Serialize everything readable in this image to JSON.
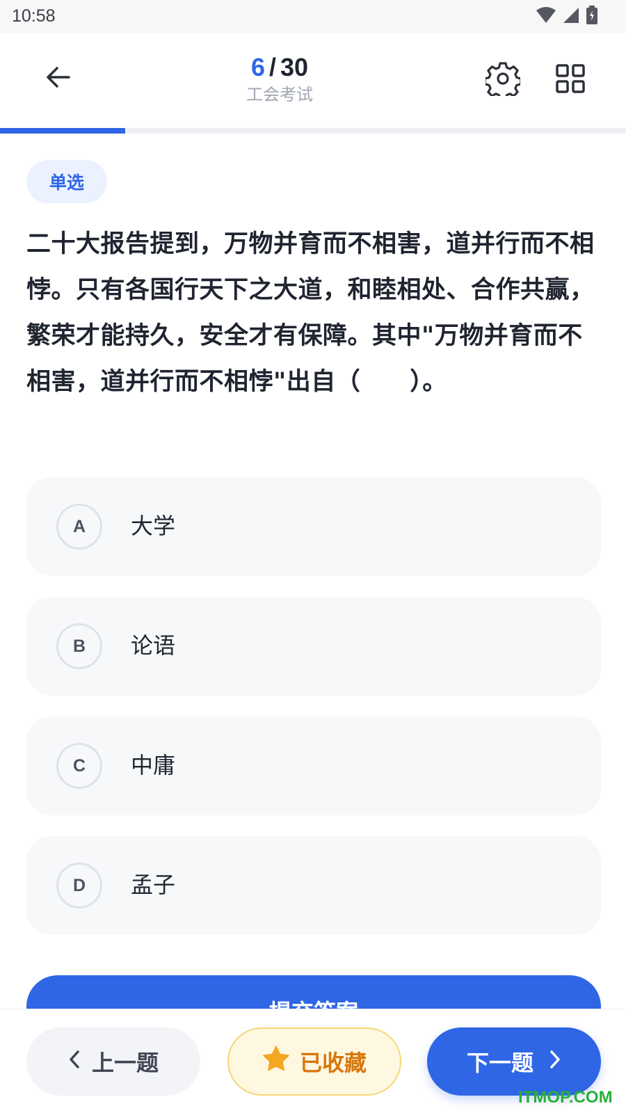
{
  "status_bar": {
    "time": "10:58"
  },
  "header": {
    "current": "6",
    "separator": "/",
    "total": "30",
    "exam_name": "工会考试"
  },
  "progress": {
    "fraction": 0.2,
    "color": "#2f66e6"
  },
  "question": {
    "type_label": "单选",
    "text": "二十大报告提到，万物并育而不相害，道并行而不相悖。只有各国行天下之大道，和睦相处、合作共赢，繁荣才能持久，安全才有保障。其中\"万物并育而不相害，道并行而不相悖\"出自（　　）。"
  },
  "options": [
    {
      "letter": "A",
      "text": "大学"
    },
    {
      "letter": "B",
      "text": "论语"
    },
    {
      "letter": "C",
      "text": "中庸"
    },
    {
      "letter": "D",
      "text": "孟子"
    }
  ],
  "submit": {
    "label": "提交答案"
  },
  "footer": {
    "prev_label": "上一题",
    "favorite_label": "已收藏",
    "next_label": "下一题"
  },
  "watermark": "ITMOP.COM",
  "colors": {
    "primary": "#2f66e6",
    "favorite": "#d9770b",
    "favorite_bg": "#fff8e1"
  },
  "icons": [
    "wifi-icon",
    "signal-icon",
    "battery-icon",
    "back-arrow-icon",
    "settings-gear-icon",
    "grid-icon",
    "chevron-left-icon",
    "star-icon",
    "chevron-right-icon"
  ]
}
